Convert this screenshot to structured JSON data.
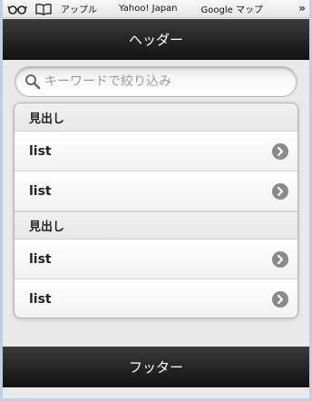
{
  "bookmarks": {
    "items": [
      "アップル",
      "Yahoo! Japan",
      "Google マップ"
    ],
    "more": "»"
  },
  "header": {
    "title": "ヘッダー"
  },
  "search": {
    "placeholder": "キーワードで絞り込み"
  },
  "list": {
    "groups": [
      {
        "title": "見出し",
        "items": [
          "list",
          "list"
        ]
      },
      {
        "title": "見出し",
        "items": [
          "list",
          "list"
        ]
      }
    ]
  },
  "footer": {
    "title": "フッター"
  },
  "icons": {
    "bookmarks_toggle": "glasses-icon",
    "reading_list": "book-icon",
    "search": "search-icon",
    "list_arrow": "chevron-right-icon"
  },
  "colors": {
    "bar_dark": "#111111",
    "bar_light": "#3c3c3c",
    "page_bg": "#e9e9e9",
    "chevron": "#888888"
  }
}
